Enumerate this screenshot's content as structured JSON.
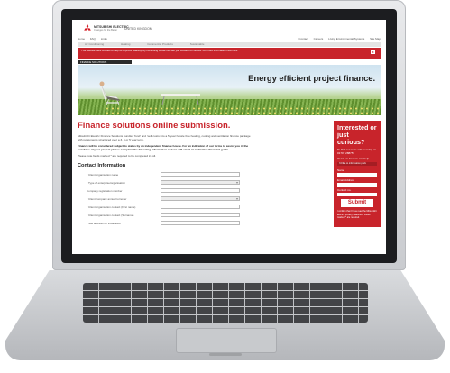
{
  "site": {
    "logo_text": "MITSUBISHI ELECTRIC",
    "logo_sub": "Changes for the Better",
    "region": "UNITED KINGDOM"
  },
  "topnav": {
    "items": [
      "Home",
      "FAQ",
      "Links"
    ]
  },
  "rightlinks": {
    "items": [
      "Contact",
      "Careers",
      "Living Environmental Systems",
      "Site Map"
    ]
  },
  "navbar": {
    "items": [
      "Air Conditioning",
      "Heating",
      "Commercial Products",
      "Sustainable"
    ]
  },
  "alert": {
    "text": "This website uses cookies to help us improve usability. By continuing to use this site you consent to cookies. For more information click here.",
    "close_label": "x"
  },
  "breadcrumb": {
    "label": "FINANCE SOLUTIONS"
  },
  "banner": {
    "headline": "Energy efficient project finance."
  },
  "main": {
    "title": "Finance solutions online submission.",
    "intro": "Mitsubishi Electric Finance Solutions bundles 'fund' and 'sell' costs into a 5-year hassle free heating, cooling and ventilation finance package with repayments structured over a 3, 4 or 5 year term.",
    "bold_note": "Finance will be considered subject to status by an independent finance house. For an indication of our terms to assist you in the purchase of your project please complete the following information and we will email an indicative financial guide.",
    "required_note": "Please note fields marked * are required to be completed in full.",
    "section_title": "Contact Information",
    "fields": [
      {
        "label": "* Client organisation name",
        "type": "text"
      },
      {
        "label": "* Type of enterprise/organisation",
        "type": "select"
      },
      {
        "label": "Company registration number",
        "type": "text"
      },
      {
        "label": "* Client company annual turnover",
        "type": "select"
      },
      {
        "label": "* Client organisation contact (First name)",
        "type": "text"
      },
      {
        "label": "* Client organisation contact (Surname)",
        "type": "text"
      },
      {
        "label": "* Site address for installation",
        "type": "text"
      }
    ]
  },
  "side": {
    "title": "Interested or just curious?",
    "call_text": "To find out more call us today on 01707 288757",
    "call_back": "Or tell us how we can help",
    "tag": "I'd like to information pack",
    "fields": [
      "Name",
      "Email Address",
      "Contact no."
    ],
    "submit_label": "Submit",
    "fine_print": "I confirm that I have read the Mitsubishi Electric privacy statement. Fields marked * are required."
  }
}
